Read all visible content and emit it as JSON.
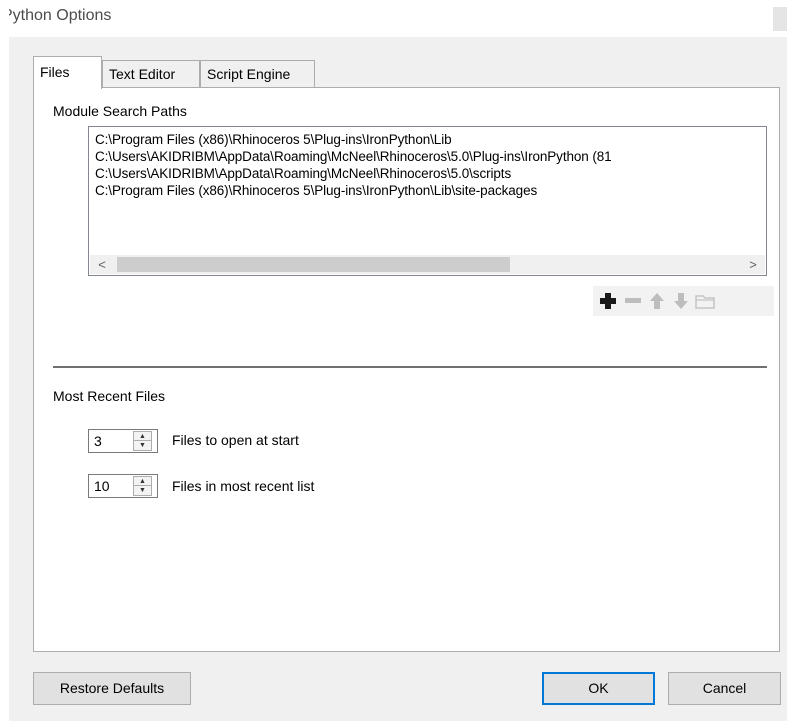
{
  "window": {
    "title": "Python Options"
  },
  "tabs": [
    {
      "label": "Files",
      "active": true
    },
    {
      "label": "Text Editor",
      "active": false
    },
    {
      "label": "Script Engine",
      "active": false
    }
  ],
  "module_search_paths": {
    "label": "Module Search Paths",
    "items": [
      "C:\\Program Files (x86)\\Rhinoceros 5\\Plug-ins\\IronPython\\Lib",
      "C:\\Users\\AKIDRIBM\\AppData\\Roaming\\McNeel\\Rhinoceros\\5.0\\Plug-ins\\IronPython (81",
      "C:\\Users\\AKIDRIBM\\AppData\\Roaming\\McNeel\\Rhinoceros\\5.0\\scripts",
      "C:\\Program Files (x86)\\Rhinoceros 5\\Plug-ins\\IronPython\\Lib\\site-packages"
    ],
    "scroll_left_glyph": "<",
    "scroll_right_glyph": ">",
    "toolbar_icons": [
      "add-icon",
      "remove-icon",
      "move-up-icon",
      "move-down-icon",
      "folder-icon"
    ]
  },
  "most_recent_files": {
    "label": "Most Recent Files",
    "files_to_open": {
      "value": "3",
      "label": "Files to open at start"
    },
    "files_in_list": {
      "value": "10",
      "label": "Files in most recent list"
    }
  },
  "buttons": {
    "restore_defaults": "Restore Defaults",
    "ok": "OK",
    "cancel": "Cancel"
  },
  "colors": {
    "accent": "#0078d7",
    "dialog_bg": "#f0f0f0",
    "panel_bg": "#ffffff"
  }
}
